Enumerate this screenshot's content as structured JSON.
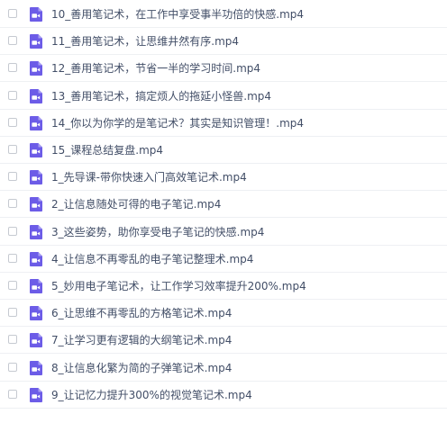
{
  "icon_name": "video-file-icon",
  "icon_color": "#6c5ce7",
  "files": [
    {
      "name": "10_善用笔记术，在工作中享受事半功倍的快感.mp4"
    },
    {
      "name": "11_善用笔记术，让思维井然有序.mp4"
    },
    {
      "name": "12_善用笔记术，节省一半的学习时间.mp4"
    },
    {
      "name": "13_善用笔记术，搞定烦人的拖延小怪兽.mp4"
    },
    {
      "name": "14_你以为你学的是笔记术？其实是知识管理！.mp4"
    },
    {
      "name": "15_课程总结复盘.mp4"
    },
    {
      "name": "1_先导课-带你快速入门高效笔记术.mp4"
    },
    {
      "name": "2_让信息随处可得的电子笔记.mp4"
    },
    {
      "name": "3_这些姿势，助你享受电子笔记的快感.mp4"
    },
    {
      "name": "4_让信息不再零乱的电子笔记整理术.mp4"
    },
    {
      "name": "5_妙用电子笔记术，让工作学习效率提升200%.mp4"
    },
    {
      "name": "6_让思维不再零乱的方格笔记术.mp4"
    },
    {
      "name": "7_让学习更有逻辑的大纲笔记术.mp4"
    },
    {
      "name": "8_让信息化繁为简的子弹笔记术.mp4"
    },
    {
      "name": "9_让记忆力提升300%的视觉笔记术.mp4"
    }
  ]
}
